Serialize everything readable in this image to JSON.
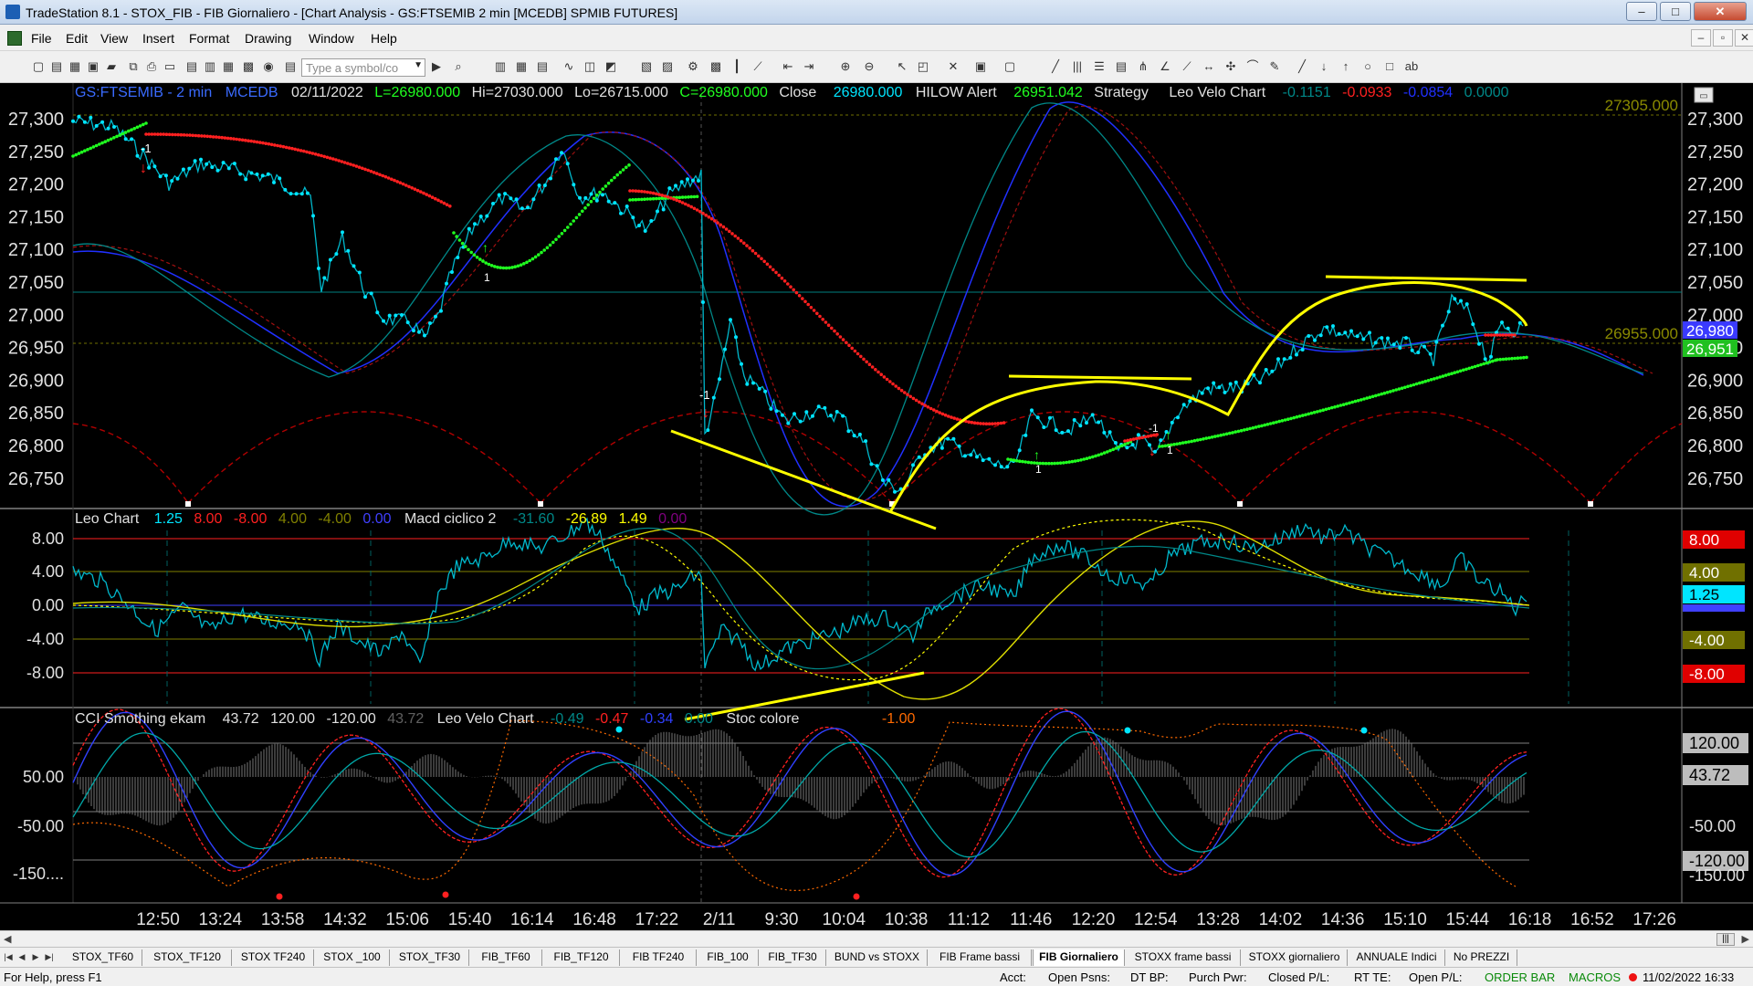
{
  "window": {
    "title": "TradeStation 8.1 - STOX_FIB - FIB Giornaliero - [Chart Analysis - GS:FTSEMIB  2 min  [MCEDB] SPMIB FUTURES]",
    "minimize": "–",
    "maximize": "□",
    "close": "✕"
  },
  "menu": {
    "items": [
      "File",
      "Edit",
      "View",
      "Insert",
      "Format",
      "Drawing",
      "Window",
      "Help"
    ],
    "mdi": [
      "–",
      "▫",
      "✕"
    ]
  },
  "toolbar": {
    "symbol_placeholder": "Type a symbol/co"
  },
  "chart": {
    "header": {
      "symbol": "GS:FTSEMIB - 2 min",
      "feed": "MCEDB",
      "date": "02/11/2022",
      "low_label": "L=26980.000",
      "high": "Hi=27030.000",
      "lo": "Lo=26715.000",
      "close_c": "C=26980.000",
      "close_word": "Close",
      "close_val": "26980.000",
      "hilow": "HILOW Alert",
      "hilow_val": "26951.042",
      "strategy": "Strategy",
      "leo": "Leo Velo Chart",
      "v1": "-0.1151",
      "v2": "-0.0933",
      "v3": "-0.0854",
      "v4": "0.0000"
    },
    "price_axis": [
      "27,300",
      "27,250",
      "27,200",
      "27,150",
      "27,100",
      "27,050",
      "27,000",
      "26,950",
      "26,900",
      "26,850",
      "26,800",
      "26,750"
    ],
    "level_labels": {
      "top": "27305.000",
      "mid": "26955.000"
    },
    "price_tags": {
      "last": "26,980",
      "hilow": "26,951"
    },
    "pane2": {
      "name": "Leo Chart",
      "vals": [
        "1.25",
        "8.00",
        "-8.00",
        "4.00",
        "-4.00",
        "0.00"
      ],
      "name2": "Macd ciclico 2",
      "vals2": [
        "-31.60",
        "-26.89",
        "1.49",
        "0.00"
      ],
      "axis": [
        "8.00",
        "4.00",
        "0.00",
        "-4.00",
        "-8.00"
      ],
      "tags": [
        "8.00",
        "4.00",
        "1.25",
        "-4.00",
        "-8.00"
      ]
    },
    "pane3": {
      "name": "CCI Smothing ekam",
      "vals": [
        "43.72",
        "120.00",
        "-120.00",
        "43.72"
      ],
      "name2": "Leo Velo Chart",
      "vals2": [
        "-0.49",
        "-0.47",
        "-0.34",
        "0.00"
      ],
      "name3": "Stoc colore",
      "val3": "-1.00",
      "axis": [
        "50.00",
        "-50.00",
        "-150...."
      ],
      "tags": [
        "120.00",
        "43.72",
        "-50.00",
        "-120.00",
        "-150.00"
      ]
    },
    "time_axis": [
      "12:50",
      "13:24",
      "13:58",
      "14:32",
      "15:06",
      "15:40",
      "16:14",
      "16:48",
      "17:22",
      "2/11",
      "9:30",
      "10:04",
      "10:38",
      "11:12",
      "11:46",
      "12:20",
      "12:54",
      "13:28",
      "14:02",
      "14:36",
      "15:10",
      "15:44",
      "16:18",
      "16:52",
      "17:26"
    ],
    "colors": {
      "cyan": "#00e5ff",
      "red": "#ff2020",
      "green": "#20ff20",
      "yellow": "#ffff00",
      "blue": "#2030ff",
      "teal": "#008888",
      "orange": "#ff6a00"
    }
  },
  "tabs": [
    "STOX_TF60",
    "STOX_TF120",
    "STOX TF240",
    "STOX _100",
    "STOX_TF30",
    "FIB_TF60",
    "FIB_TF120",
    "FIB TF240",
    "FIB_100",
    "FIB_TF30",
    "BUND vs STOXX",
    "FIB Frame bassi",
    "FIB Giornaliero",
    "STOXX frame bassi",
    "STOXX giornaliero",
    "ANNUALE Indici",
    "No PREZZI"
  ],
  "status": {
    "help": "For Help, press F1",
    "acct": "Acct:",
    "open_psns": "Open Psns:",
    "dt_bp": "DT BP:",
    "purch_pwr": "Purch Pwr:",
    "closed_pl": "Closed P/L:",
    "rt_te": "RT TE:",
    "open_pl": "Open P/L:",
    "order_bar": "ORDER BAR",
    "macros": "MACROS",
    "datetime": "11/02/2022 16:33"
  }
}
